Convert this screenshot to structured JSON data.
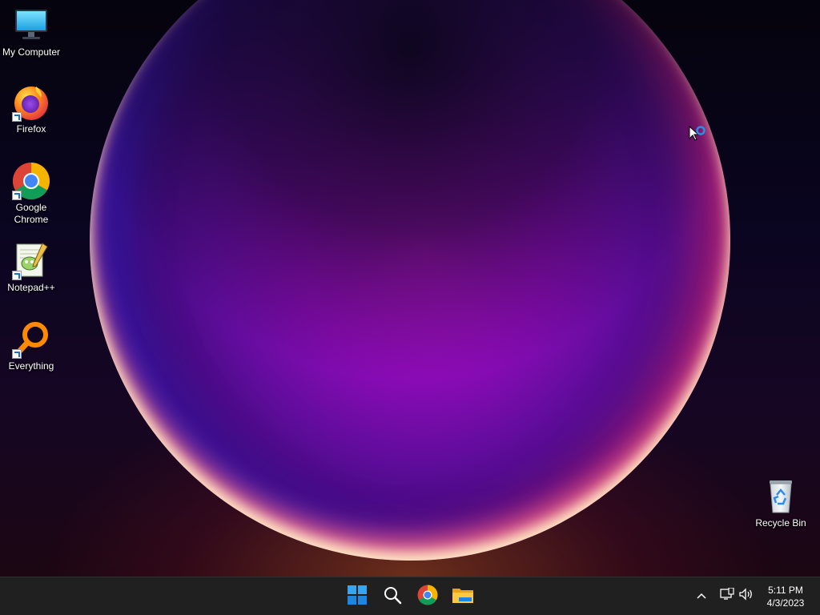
{
  "desktop": {
    "icons": [
      {
        "label": "My Computer"
      },
      {
        "label": "Firefox"
      },
      {
        "label": "Google\nChrome"
      },
      {
        "label": "Notepad++"
      },
      {
        "label": "Everything"
      },
      {
        "label": "Recycle Bin"
      }
    ]
  },
  "taskbar": {
    "pinned": [
      "start-icon",
      "search-icon",
      "chrome-icon",
      "file-explorer-icon"
    ],
    "tray_icons": [
      "chevron-up-icon",
      "network-icon",
      "volume-icon"
    ],
    "clock": {
      "time": "5:11 PM",
      "date": "4/3/2023"
    }
  },
  "cursor": {
    "state": "busy"
  },
  "colors": {
    "taskbar_bg": "#202020",
    "accent_blue": "#2a8cf0",
    "orb_magenta": "#b512cc"
  }
}
